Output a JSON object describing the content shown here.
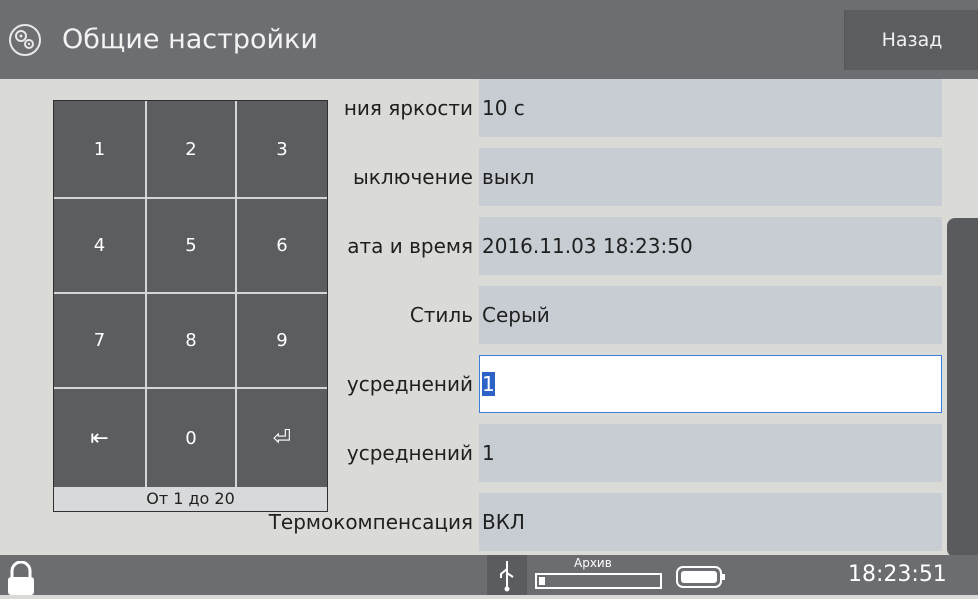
{
  "header": {
    "title": "Общие настройки",
    "back_label": "Назад",
    "icon": "gears-icon"
  },
  "settings": [
    {
      "label": "ния яркости",
      "value": "10 с"
    },
    {
      "label": "ыключение",
      "value": "выкл"
    },
    {
      "label": "ата и время",
      "value": "2016.11.03 18:23:50"
    },
    {
      "label": "Стиль",
      "value": "Серый"
    },
    {
      "label": "усреднений",
      "value": "1"
    },
    {
      "label": "усреднений",
      "value": "1"
    },
    {
      "label": "Термокомпенсация",
      "value": "ВКЛ"
    }
  ],
  "keypad": {
    "keys": [
      "1",
      "2",
      "3",
      "4",
      "5",
      "6",
      "7",
      "8",
      "9",
      "⇤",
      "0",
      "⏎"
    ],
    "range_hint": "От 1 до 20"
  },
  "statusbar": {
    "archive_label": "Архив",
    "archive_fill": 0.05,
    "clock": "18:23:51",
    "icons": [
      "lock-icon",
      "usb-icon",
      "battery-icon"
    ]
  },
  "colors": {
    "header_bg": "#6d6e71",
    "keypad_bg": "#5c5d61",
    "field_bg": "#c8cdd3",
    "selection": "#2d63c8"
  }
}
